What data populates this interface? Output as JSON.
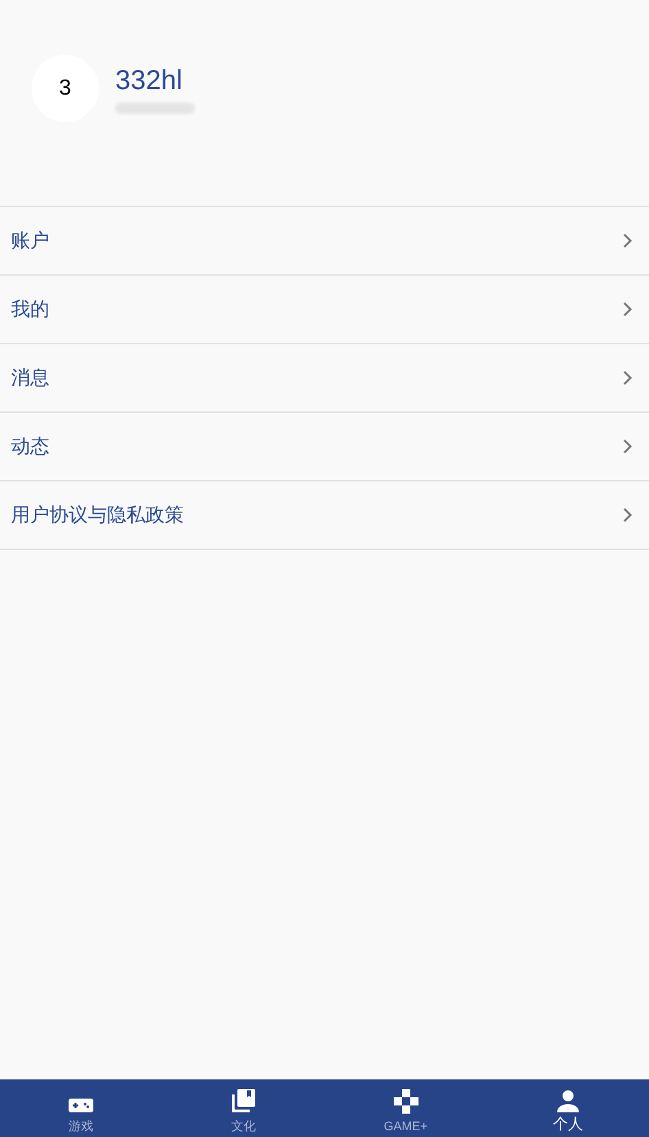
{
  "profile": {
    "avatar": "3",
    "name": "332hl"
  },
  "menu": [
    {
      "label": "账户"
    },
    {
      "label": "我的"
    },
    {
      "label": "消息"
    },
    {
      "label": "动态"
    },
    {
      "label": "用户协议与隐私政策"
    }
  ],
  "tabs": [
    {
      "label": "游戏",
      "kind": "gamepad",
      "selected": false
    },
    {
      "label": "文化",
      "kind": "library",
      "selected": false
    },
    {
      "label": "GAME+",
      "kind": "dpad",
      "selected": false
    },
    {
      "label": "个人",
      "kind": "person",
      "selected": true
    }
  ]
}
